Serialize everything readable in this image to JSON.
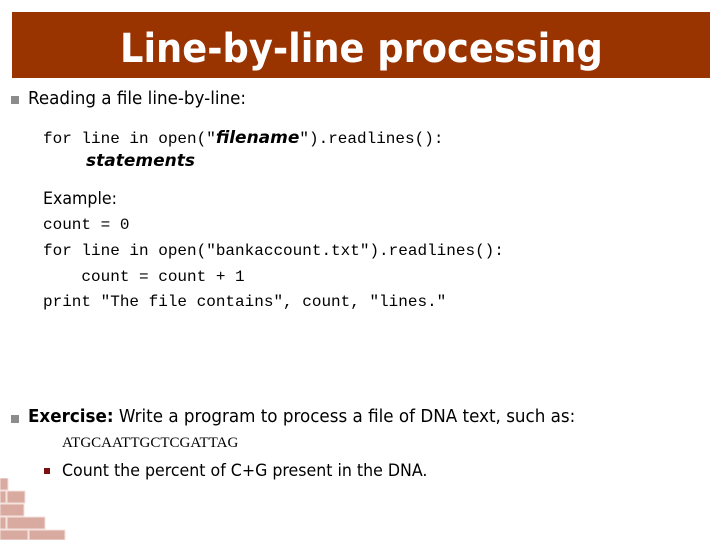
{
  "title": "Line-by-line processing",
  "bullet1": {
    "text": "Reading a file line-by-line:",
    "syntax": {
      "line1_prefix": "for line in open(\"",
      "line1_filename": "filename",
      "line1_suffix": "\").readlines():",
      "line2": "statements"
    },
    "example_label": "Example:",
    "example_code": [
      "count = 0",
      "for line in open(\"bankaccount.txt\").readlines():",
      "    count = count + 1",
      "print \"The file contains\", count, \"lines.\""
    ]
  },
  "bullet2": {
    "label": "Exercise:",
    "text": " Write a program to process a file of DNA text, such as:",
    "dna": "ATGCAATTGCTCGATTAG",
    "sub_bullet": "Count the percent of C+G present in the DNA."
  },
  "colors": {
    "title_bar": "#993300",
    "bullet": "#8c8c8c",
    "sub_bullet": "#7a1010"
  }
}
